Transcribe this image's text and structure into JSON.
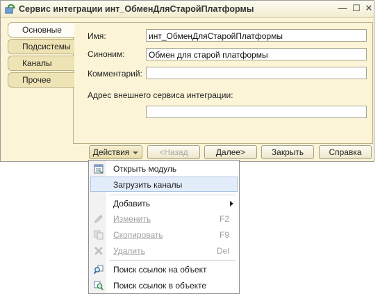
{
  "window": {
    "title": "Сервис интеграции инт_ОбменДляСтаройПлатформы",
    "controls": {
      "minimize": "—",
      "maximize": "☐",
      "close": "✕"
    }
  },
  "tabs": [
    {
      "label": "Основные",
      "active": true
    },
    {
      "label": "Подсистемы",
      "active": false
    },
    {
      "label": "Каналы",
      "active": false
    },
    {
      "label": "Прочее",
      "active": false
    }
  ],
  "form": {
    "name_label": "Имя:",
    "name_value": "инт_ОбменДляСтаройПлатформы",
    "synonym_label": "Синоним:",
    "synonym_value": "Обмен для старой платформы",
    "comment_label": "Комментарий:",
    "comment_value": "",
    "address_label": "Адрес внешнего сервиса интеграции:",
    "address_value": ""
  },
  "buttons": {
    "actions": "Действия",
    "back": "<Назад",
    "next": "Далее>",
    "close": "Закрыть",
    "help": "Справка"
  },
  "menu": {
    "items": [
      {
        "label": "Открыть модуль",
        "shortcut": "",
        "enabled": true,
        "icon": "module-icon"
      },
      {
        "label": "Загрузить каналы",
        "shortcut": "",
        "enabled": true,
        "highlighted": true,
        "icon": ""
      },
      {
        "label": "Добавить",
        "shortcut": "",
        "enabled": true,
        "submenu": true,
        "icon": ""
      },
      {
        "label": "Изменить",
        "shortcut": "F2",
        "enabled": false,
        "icon": "pencil-icon"
      },
      {
        "label": "Скопировать",
        "shortcut": "F9",
        "enabled": false,
        "icon": "copy-icon"
      },
      {
        "label": "Удалить",
        "shortcut": "Del",
        "enabled": false,
        "icon": "delete-icon"
      },
      {
        "label": "Поиск ссылок на объект",
        "shortcut": "",
        "enabled": true,
        "icon": "find-references-icon"
      },
      {
        "label": "Поиск ссылок в объекте",
        "shortcut": "",
        "enabled": true,
        "icon": "find-in-object-icon"
      }
    ]
  }
}
